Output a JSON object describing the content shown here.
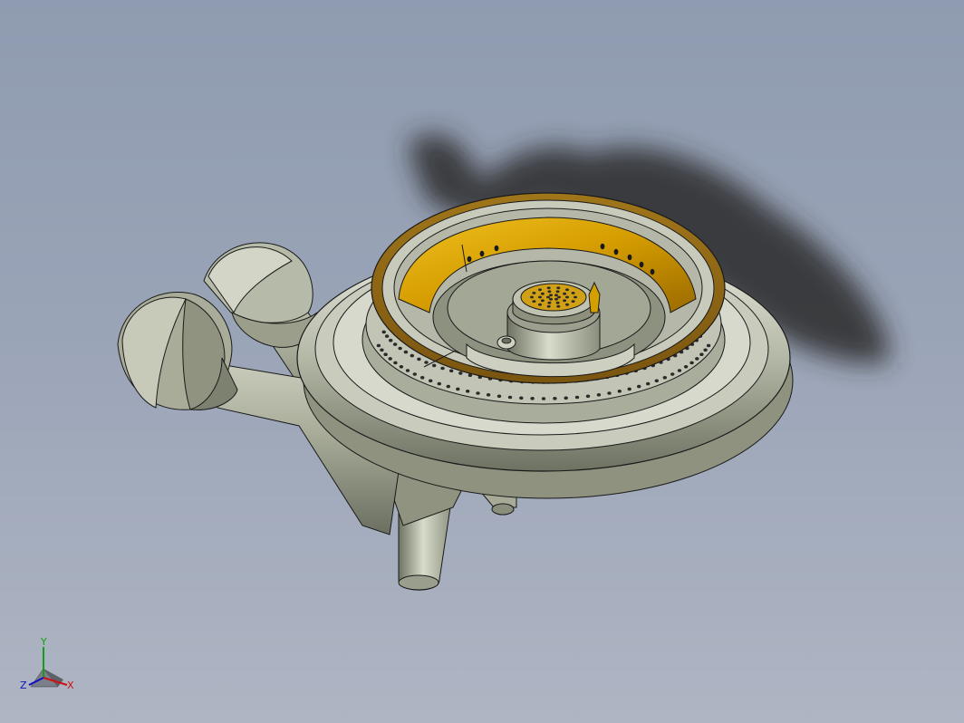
{
  "viewport": {
    "background_top": "#8f9bb0",
    "background_bottom": "#aeb5c3"
  },
  "model": {
    "part_color": "#b8bcac",
    "brass_color": "#d4a000",
    "edge_color": "#1a1a1a"
  },
  "triad": {
    "x_label": "X",
    "y_label": "Y",
    "z_label": "Z",
    "x_color": "#d01010",
    "y_color": "#10a010",
    "z_color": "#1010c0"
  }
}
